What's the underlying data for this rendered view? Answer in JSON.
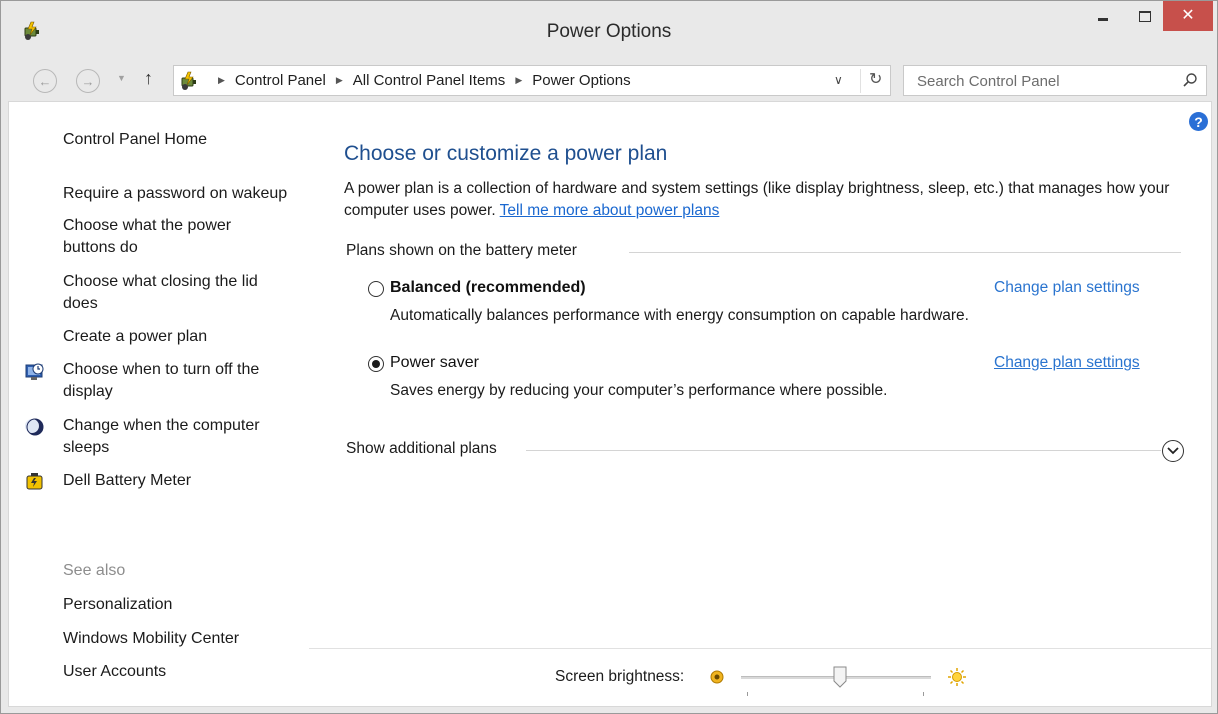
{
  "window": {
    "title": "Power Options",
    "close_symbol": "✕"
  },
  "nav": {
    "back_icon": "back-arrow-icon",
    "forward_icon": "forward-arrow-icon",
    "up_symbol": "↑",
    "breadcrumbs": [
      "Control Panel",
      "All Control Panel Items",
      "Power Options"
    ],
    "search_placeholder": "Search Control Panel"
  },
  "help_symbol": "?",
  "left_pane": {
    "home": "Control Panel Home",
    "links": [
      "Require a password on wakeup",
      "Choose what the power buttons do",
      "Choose what closing the lid does",
      "Create a power plan",
      "Choose when to turn off the display",
      "Change when the computer sleeps",
      "Dell Battery Meter"
    ],
    "see_also": {
      "heading": "See also",
      "links": [
        "Personalization",
        "Windows Mobility Center",
        "User Accounts"
      ]
    }
  },
  "main": {
    "heading": "Choose or customize a power plan",
    "description": "A power plan is a collection of hardware and system settings (like display brightness, sleep, etc.) that manages how your computer uses power.",
    "learn_more": "Tell me more about power plans",
    "plans_label": "Plans shown on the battery meter",
    "plans": [
      {
        "name": "Balanced (recommended)",
        "description": "Automatically balances performance with energy consumption on capable hardware.",
        "settings_link": "Change plan settings",
        "selected": false
      },
      {
        "name": "Power saver",
        "description": "Saves energy by reducing your computer’s performance where possible.",
        "settings_link": "Change plan settings",
        "selected": true
      }
    ],
    "show_additional": "Show additional plans"
  },
  "brightness": {
    "label": "Screen brightness:",
    "level_percent": 52
  },
  "colors": {
    "accent_link": "#2a74cf",
    "heading": "#1f4f8f",
    "close_button": "#c7504b",
    "help": "#2a6fd6"
  }
}
